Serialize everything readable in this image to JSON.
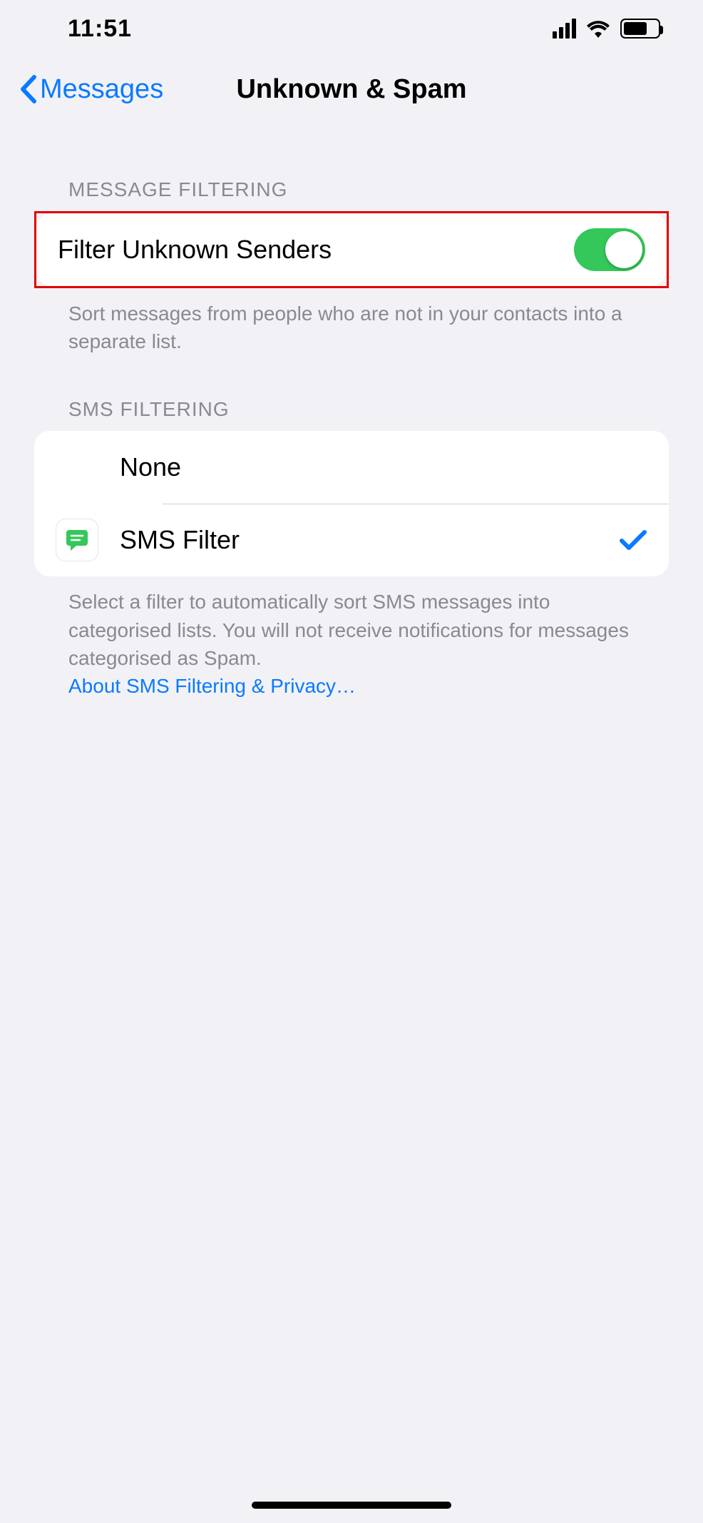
{
  "status": {
    "time": "11:51"
  },
  "nav": {
    "back_label": "Messages",
    "title": "Unknown & Spam"
  },
  "message_filtering": {
    "header": "MESSAGE FILTERING",
    "item_label": "Filter Unknown Senders",
    "toggle_on": true,
    "footer": "Sort messages from people who are not in your contacts into a separate list."
  },
  "sms_filtering": {
    "header": "SMS FILTERING",
    "options": [
      {
        "label": "None",
        "selected": false,
        "icon": null
      },
      {
        "label": "SMS Filter",
        "selected": true,
        "icon": "sms-filter-app"
      }
    ],
    "footer_text": "Select a filter to automatically sort SMS messages into categorised lists. You will not receive notifications for messages categorised as Spam.",
    "footer_link": "About SMS Filtering & Privacy…"
  }
}
